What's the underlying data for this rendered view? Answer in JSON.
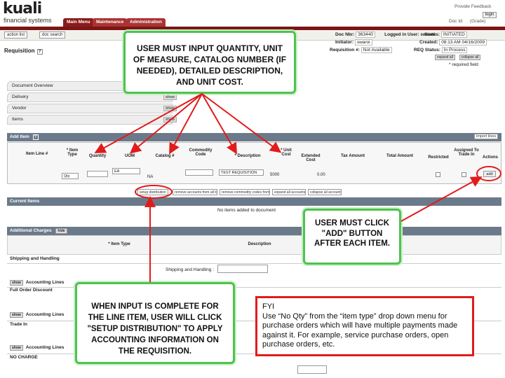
{
  "header": {
    "logo_word": "kuali",
    "logo_sub": "financial systems",
    "tabs": [
      "Main Menu",
      "Maintenance",
      "Administration"
    ],
    "links": [
      "Provide Feedback",
      "Doc Id:",
      "(Grade)"
    ],
    "login_label": "login"
  },
  "toolbar": {
    "buttons": [
      "action list",
      "doc search"
    ],
    "logged_in": "Logged in User: swaroi"
  },
  "document": {
    "title": "Requisition",
    "help": "?",
    "doc_nbr_label": "Doc Nbr:",
    "doc_nbr": "363440",
    "status_label": "Status:",
    "status": "INITIATED",
    "initiator_label": "Initiator:",
    "initiator": "swaroi",
    "created_label": "Created:",
    "created": "08:13 AM 04/16/2009",
    "req_label": "Requisition #:",
    "req": "Not Available",
    "req_status_label": "REQ Status:",
    "req_status": "In Process",
    "expand_all": "expand all",
    "collapse_all": "collapse all",
    "required_note": "* required field"
  },
  "tabs": {
    "overview": "Document Overview",
    "delivery": "Delivery",
    "vendor": "Vendor",
    "items": "Items",
    "show": "show"
  },
  "items": {
    "add_item_label": "Add Item",
    "import_lines": "import lines",
    "columns": [
      "Item Line #",
      "* Item Type",
      "Quantity",
      "UOM",
      "Catalog #",
      "Commodity Code",
      "* Description",
      "* Unit Cost",
      "Extended Cost",
      "Tax Amount",
      "Total Amount",
      "Restricted",
      "Assigned To Trade In",
      "Actions"
    ],
    "row": {
      "item_type": "Qty",
      "uom": "EA",
      "catalog": "NA",
      "description": "TEST REQUISITION",
      "unit_cost": "5000",
      "extended": "0.00"
    },
    "add_button": "add",
    "sub_buttons": [
      "setup distribution",
      "remove accounts from all items",
      "remove commodity codes from all items",
      "expand all accounts",
      "collapse all accounts"
    ],
    "current_items": "Current Items",
    "no_items": "No items added to document"
  },
  "charges": {
    "title": "Additional Charges",
    "hide": "hide",
    "item_type_col": "* Item Type",
    "description_col": "Description",
    "rows": [
      "Shipping and Handling",
      "Full Order Discount",
      "Trade In",
      "NO CHARGE"
    ],
    "shipping_field_label": "Shipping and Handling :",
    "accounting_lines": "Accounting Lines",
    "show": "show"
  },
  "callouts": {
    "top": "USER MUST INPUT QUANTITY, UNIT OF MEASURE, CATALOG NUMBER (IF NEEDED), DETAILED DESCRIPTION, AND UNIT COST.",
    "add": "USER MUST CLICK \"ADD\" BUTTON AFTER EACH ITEM.",
    "bottom": "WHEN INPUT IS COMPLETE FOR THE LINE ITEM, USER WILL CLICK \"SETUP DISTRIBUTION\" TO APPLY ACCOUNTING INFORMATION ON THE REQUISITION.",
    "fyi_title": "FYI",
    "fyi_text": "Use “No Qty” from the “item type” drop down menu for purchase orders which will have multiple payments made against it.  For example, service purchase orders, open purchase orders, etc."
  },
  "colors": {
    "brand_red": "#7b1515",
    "callout_green": "#4fc24f",
    "arrow_red": "#e21b1b",
    "section_bar": "#6b7a8a"
  }
}
